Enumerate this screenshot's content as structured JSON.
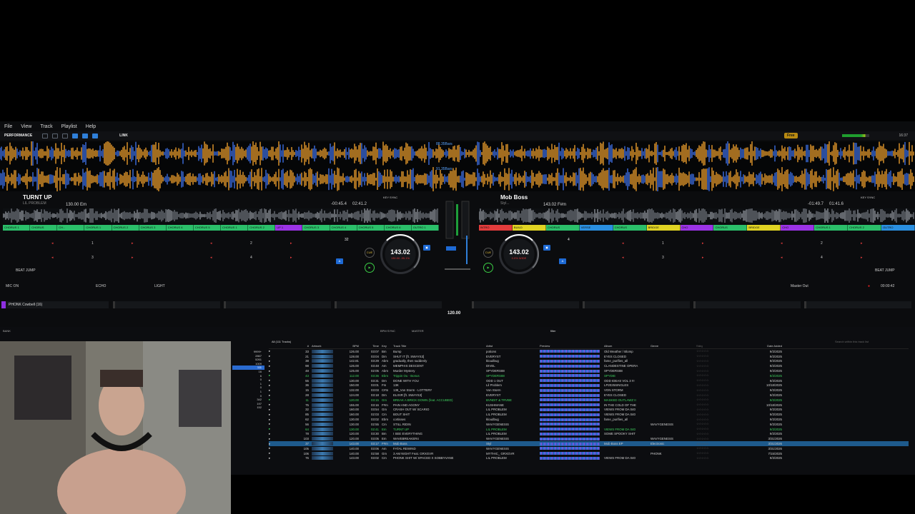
{
  "menu": [
    "File",
    "View",
    "Track",
    "Playlist",
    "Help"
  ],
  "toolbar": {
    "mode": "PERFORMANCE",
    "link": "LINK",
    "free": "Free",
    "clock": "16:37"
  },
  "overview": {
    "label_top": "88.35Bars",
    "label_bottom": "91.35Bars"
  },
  "deck_left": {
    "title": "TURNT UP",
    "artist": "LIL PROBLEM",
    "key": "130.00 Em",
    "time_elapsed": "-00:45.4",
    "time_total": "02:41.2",
    "keysync": "KEY SYNC",
    "bpm": "143.02",
    "bpm_sub": "130.00 -95.1%",
    "loop": "32",
    "cues": [
      "CHORUS 1",
      "CHORUS",
      "CH...",
      "CHORUS 1",
      "CHORUS 2",
      "CHORUS 3",
      "CHORUS 4",
      "CHORUS 5",
      "CHORUS 1",
      "CHORUS 2",
      "UP 1",
      "CHORUS 3",
      "CHORUS 4",
      "CHORUS 5",
      "CHORUS 6",
      "OUTRO 1"
    ],
    "pads": [
      "1",
      "2",
      "3",
      "4"
    ],
    "beatjump": "BEAT JUMP"
  },
  "deck_right": {
    "title": "Mob Boss",
    "artist": "Styl...",
    "key": "143.02 F#m",
    "time_elapsed": "-01:49.7",
    "time_total": "01:41.6",
    "keysync": "KEY SYNC",
    "bpm": "143.02",
    "bpm_sub": "0.0% WIDE",
    "loop": "4",
    "cues": [
      "INTRO",
      "BUILD",
      "CHORUS",
      "VERSE",
      "CHORUS",
      "BRIDGE",
      "CHO",
      "CHORUS",
      "BRIDGE",
      "CHO",
      "CHORUS 1",
      "CHORUS 2",
      "OUTRO"
    ],
    "pads": [
      "1",
      "2",
      "3",
      "4"
    ],
    "beatjump": "BEAT JUMP"
  },
  "mixer": {
    "master_bpm": "120.00",
    "master_out": "Master Out",
    "master_time": "00:00:42"
  },
  "fx": {
    "mic": "MIC ON",
    "echo": "ECHO",
    "light": "LIGHT"
  },
  "sampler": {
    "slot1": "PHONK Cowbell (16)",
    "bank": "BANK"
  },
  "browser": {
    "count": "All (111 Tracks)",
    "bpm_sync": "BPM SYNC",
    "master": "MASTER",
    "filter": "filter",
    "search_placeholder": "Search within this track list",
    "headers": [
      "",
      "#",
      "Artwork",
      "BPM",
      "Time",
      "Key",
      "Track Title",
      "Artist",
      "Preview",
      "Album",
      "Genre",
      "Rating",
      "Date Added"
    ],
    "tree": [
      "9999+",
      "2867",
      "5261",
      "1009",
      "111",
      "16",
      "6",
      "0",
      "1",
      "0",
      "1",
      "0",
      "342",
      "197",
      "152"
    ],
    "rows": [
      [
        "33",
        "",
        "126.00",
        "03:07",
        "Bm",
        "Bump",
        "potions",
        "",
        "Old Weather / Blomp",
        "",
        "",
        "9/2/2025"
      ],
      [
        "21",
        "",
        "128.00",
        "03:04",
        "Dm",
        "SHUT IT [ft. SWAYS3]",
        "EVERYST",
        "",
        "EYES CLOSED",
        "",
        "",
        "9/2/2025"
      ],
      [
        "38",
        "",
        "142.81",
        "03:29",
        "Abm",
        "gradually, then suddenly",
        "kloudbug",
        "",
        "fame_purifies_all",
        "",
        "",
        "9/2/2025"
      ],
      [
        "98",
        "",
        "126.00",
        "03:48",
        "Am",
        "MEMPHIS DESCENT",
        "DIVEL",
        "",
        "CLANDESTINE OPERA",
        "",
        "",
        "9/2/2025"
      ],
      [
        "48",
        "",
        "125.00",
        "02:05",
        "Abm",
        "Murder Mystery",
        "SPYDERS88",
        "",
        "SPYDERS88",
        "",
        "",
        "9/2/2025"
      ],
      [
        "43",
        "",
        "112.00",
        "03:36",
        "Ebm",
        "Trippin Ou - Bonus",
        "SPYDERS88",
        "",
        "SPYDIE",
        "",
        "",
        "9/2/2025"
      ],
      [
        "55",
        "",
        "130.00",
        "03:31",
        "Dm",
        "DONE WITH YOU",
        "ODD 1 OUT",
        "",
        "ODD IDEAS VOL 3 !!!",
        "",
        "",
        "9/2/2025"
      ],
      [
        "36",
        "",
        "150.00",
        "03:01",
        "Fm",
        "13K",
        "Lil Problem",
        "",
        "LP2025SINGLES",
        "",
        "",
        "10/18/2025"
      ],
      [
        "15",
        "",
        "132.00",
        "03:03",
        "C#m",
        "138_Von Storm - LOTTERY",
        "Von Storm",
        "",
        "VON STORM",
        "",
        "",
        "9/2/2025"
      ],
      [
        "28",
        "",
        "124.00",
        "03:18",
        "Dm",
        "ELIXIR [ft. SWAYS3]",
        "EVERYST",
        "",
        "EYES CLOSED",
        "",
        "",
        "9/2/2025"
      ],
      [
        "11",
        "",
        "120.00",
        "03:15",
        "Gm",
        "BREAK A BRICK DOWN (feat. ACCUBED)",
        "BVNDIT & TRVBE",
        "",
        "MASKED OUTLAWZ II",
        "",
        "",
        "9/2/2025"
      ],
      [
        "75",
        "",
        "155.00",
        "03:16",
        "F#m",
        "PAIN AND AGONY",
        "KUSHMANE",
        "",
        "IN THE COLD OF THE",
        "",
        "",
        "10/18/2025"
      ],
      [
        "32",
        "",
        "160.00",
        "03:54",
        "Gm",
        "CRASH OUT W/ SCARIO",
        "LIL PROBLEM",
        "",
        "VIEWS FROM DA 040",
        "",
        "",
        "9/2/2025"
      ],
      [
        "85",
        "",
        "160.00",
        "02:03",
        "Cm",
        "BOUT SHIT",
        "LIL PROBLEM",
        "",
        "VIEWS FROM DA 040",
        "",
        "",
        "9/2/2025"
      ],
      [
        "62",
        "",
        "130.00",
        "03:02",
        "Ebm",
        "cortisses",
        "kloudbug",
        "",
        "fame_purifies_all",
        "",
        "",
        "9/2/2025"
      ],
      [
        "56",
        "",
        "130.00",
        "02:55",
        "Cm",
        "STILL RIDIN",
        "WAVYGENESIS",
        "",
        "",
        "WAVYGENESIS",
        "",
        "9/2/2025"
      ],
      [
        "64",
        "",
        "130.00",
        "02:41",
        "Em",
        "TURNT UP",
        "LIL PROBLEM",
        "",
        "VIEWS FROM DA 040",
        "",
        "",
        "9/2/2025"
      ],
      [
        "78",
        "",
        "120.00",
        "03:30",
        "Bm",
        "I SEE EVERYTHING",
        "LIL PROBLEM",
        "",
        "SOME SPOOKY SHIT",
        "",
        "",
        "9/2/2025"
      ],
      [
        "103",
        "",
        "120.00",
        "03:05",
        "Em",
        "WAVEBREAKER4",
        "WAVYGENESIS",
        "",
        "",
        "WAVYGENESIS",
        "",
        "3/31/2026"
      ],
      [
        "37",
        "",
        "143.00",
        "03:17",
        "F#m",
        "Mob Boss",
        "Styl",
        "",
        "Mob Boss EP",
        "Electronic",
        "",
        "3/31/2026"
      ],
      [
        "105",
        "",
        "140.00",
        "03:06",
        "Am",
        "FATAL REWIND",
        "WAVYGENESIS",
        "",
        "",
        "",
        "",
        "3/31/2026"
      ],
      [
        "106",
        "",
        "140.00",
        "02:58",
        "Gm",
        "3 AM NIGHT Feat. GRXGVR",
        "MYTHIC_ GRXGVR",
        "",
        "",
        "PHONK",
        "",
        "7/15/2025"
      ],
      [
        "76",
        "",
        "143.00",
        "03:02",
        "Cm",
        "PHONK SHIT W/ SPACED X SOBBYVANE",
        "LIL PROBLEM",
        "",
        "VIEWS FROM DA 040",
        "",
        "",
        "9/2/2025"
      ]
    ]
  },
  "colors": {
    "accent": "#2f7fd8",
    "cue_green": "#2bbf6a",
    "cue_purple": "#9b33e6",
    "cue_yellow": "#e0d323",
    "wave_orange": "#e59a2c",
    "wave_blue": "#3c6ee0"
  }
}
